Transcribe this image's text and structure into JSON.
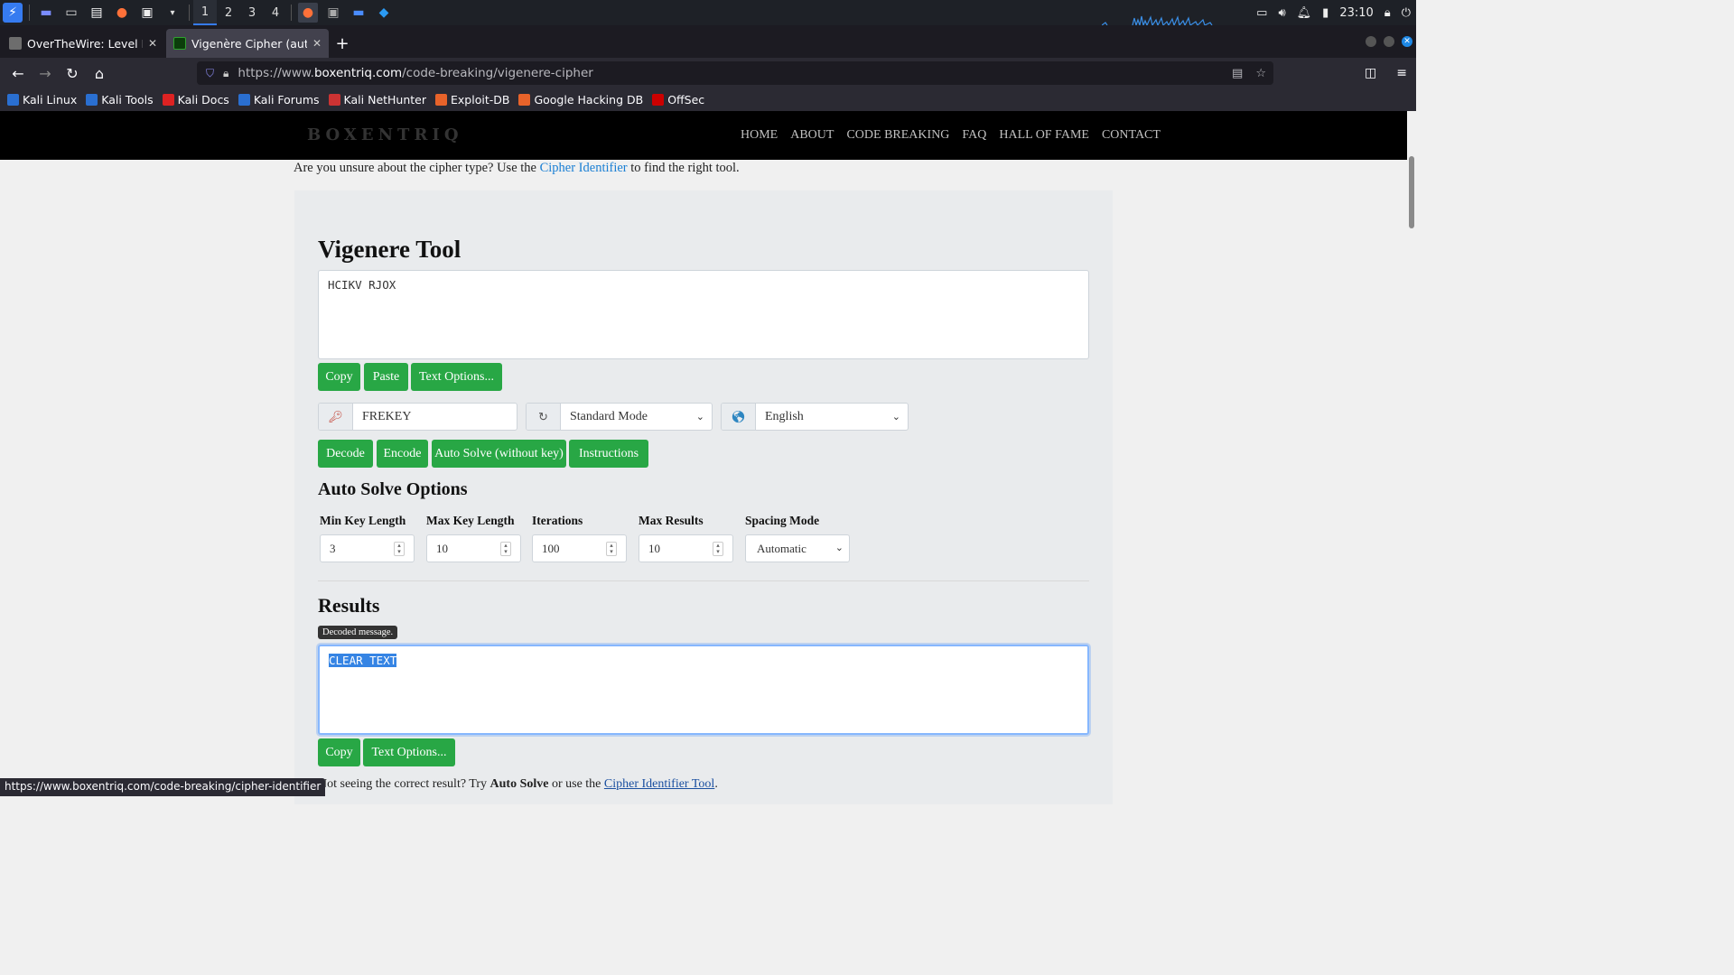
{
  "taskbar": {
    "workspaces": [
      "1",
      "2",
      "3",
      "4"
    ],
    "clock": "23:10"
  },
  "browser": {
    "tabs": [
      {
        "title": "OverTheWire: Level Info",
        "active": false
      },
      {
        "title": "Vigenère Cipher (automat",
        "active": true
      }
    ],
    "url_prefix": "https://www.",
    "url_host": "boxentriq.com",
    "url_path": "/code-breaking/vigenere-cipher",
    "bookmarks": [
      "Kali Linux",
      "Kali Tools",
      "Kali Docs",
      "Kali Forums",
      "Kali NetHunter",
      "Exploit-DB",
      "Google Hacking DB",
      "OffSec"
    ],
    "status_url": "https://www.boxentriq.com/code-breaking/cipher-identifier"
  },
  "site": {
    "logo": "BOXENTRIQ",
    "nav": [
      "HOME",
      "ABOUT",
      "CODE BREAKING",
      "FAQ",
      "HALL OF FAME",
      "CONTACT"
    ]
  },
  "content": {
    "intro_before": "Are you unsure about the cipher type? Use the ",
    "intro_link": "Cipher Identifier",
    "intro_after": " to find the right tool.",
    "tool_title": "Vigenere Tool",
    "input_text": "HCIKV RJOX",
    "input_buttons": [
      "Copy",
      "Paste",
      "Text Options..."
    ],
    "key_value": "FREKEY",
    "mode_value": "Standard Mode",
    "language_value": "English",
    "action_buttons": [
      "Decode",
      "Encode",
      "Auto Solve (without key)",
      "Instructions"
    ],
    "auto_solve_title": "Auto Solve Options",
    "options": [
      {
        "label": "Min Key Length",
        "value": "3"
      },
      {
        "label": "Max Key Length",
        "value": "10"
      },
      {
        "label": "Iterations",
        "value": "100"
      },
      {
        "label": "Max Results",
        "value": "10"
      }
    ],
    "spacing_label": "Spacing Mode",
    "spacing_value": "Automatic",
    "results_title": "Results",
    "tooltip": "Decoded message.",
    "result_text": "CLEAR TEXT",
    "result_buttons": [
      "Copy",
      "Text Options..."
    ],
    "bottom_before": "Not seeing the correct result? Try ",
    "bottom_bold": "Auto Solve",
    "bottom_middle": " or use the ",
    "bottom_link": "Cipher Identifier Tool",
    "bottom_after": "."
  },
  "colors": {
    "green_button": "#28a745",
    "link": "#1a7fd4",
    "selection": "#3584e4"
  }
}
